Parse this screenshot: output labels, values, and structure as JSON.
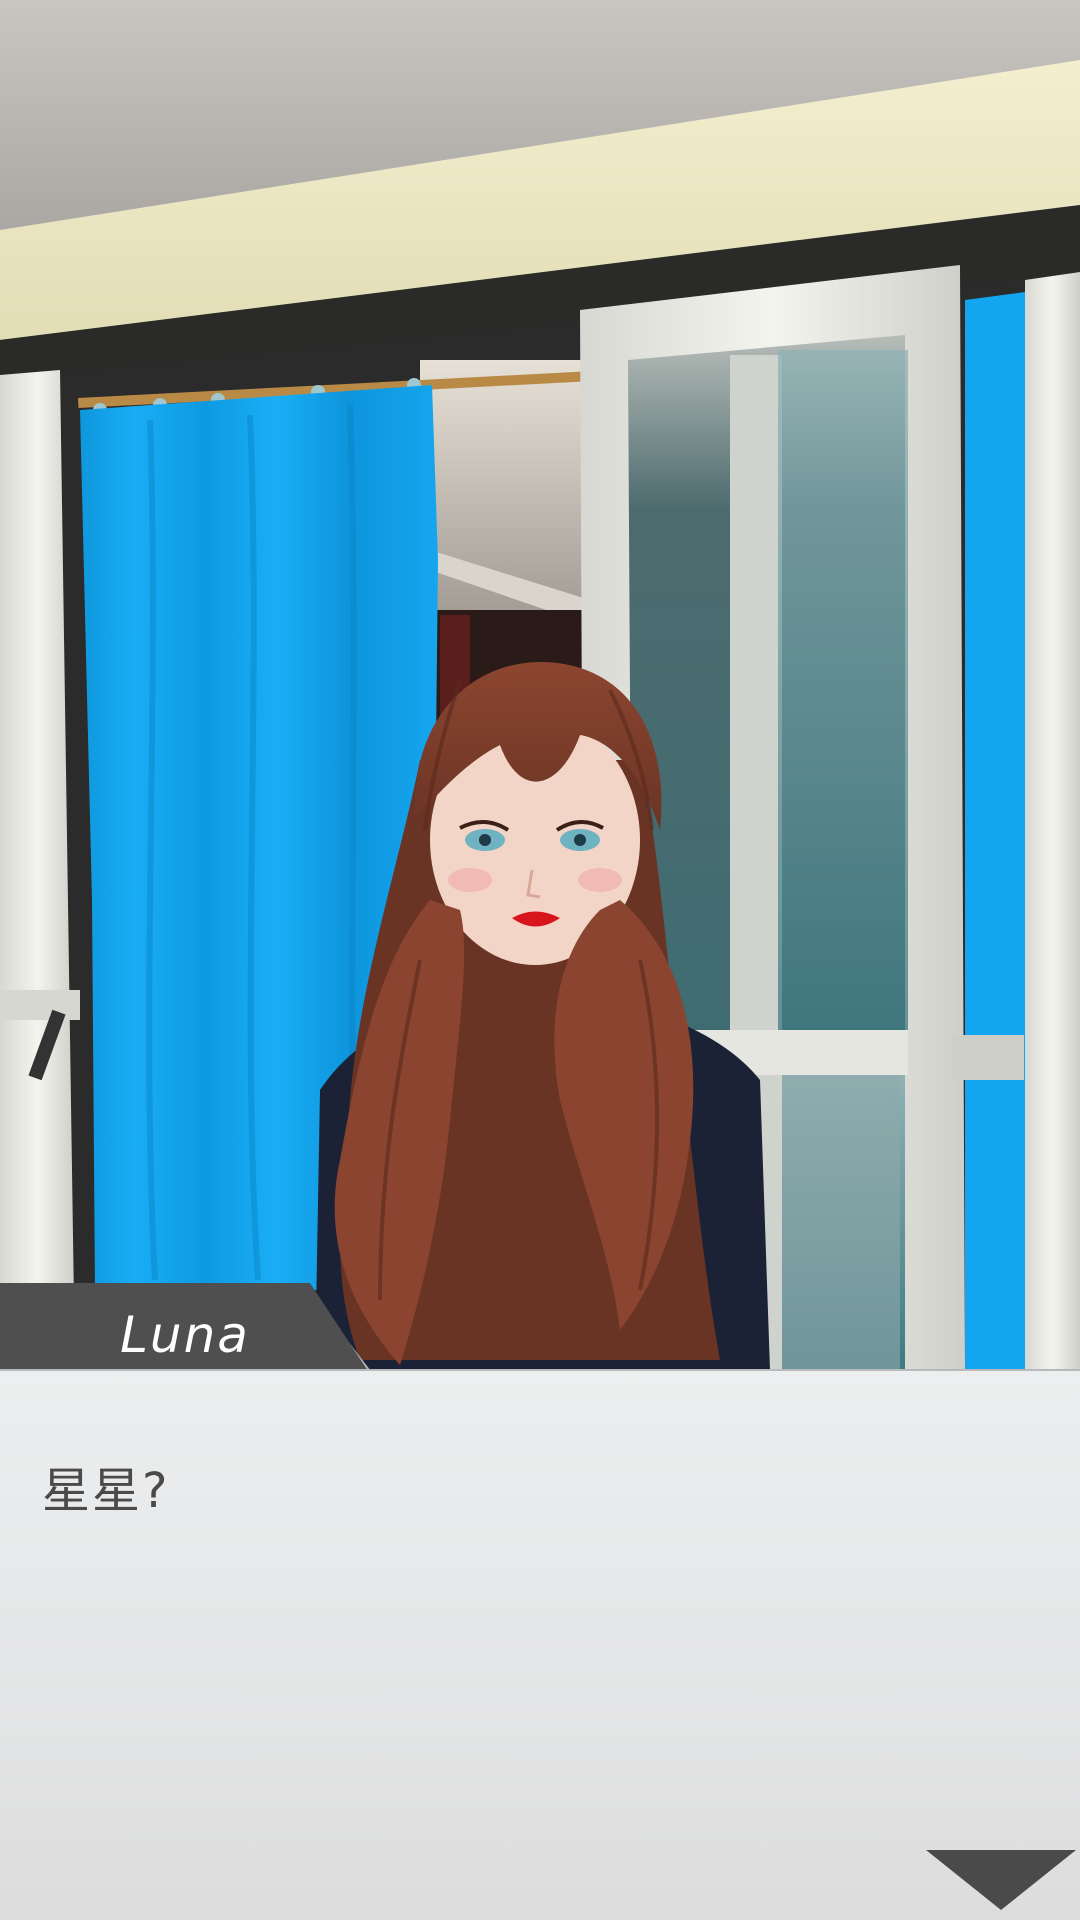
{
  "dialogue": {
    "speaker": "Luna",
    "line": "星星?"
  },
  "icons": {
    "advance": "triangle-down-icon"
  },
  "colors": {
    "curtain": "#12a6f0",
    "name_tab": "#4f4f4f",
    "dialogue_bg": "#e8e9ea",
    "dialogue_text": "#4a4a4a"
  }
}
